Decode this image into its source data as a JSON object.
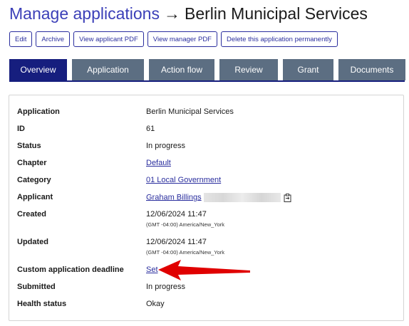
{
  "header": {
    "breadcrumb_link": "Manage applications",
    "arrow": "→",
    "application_name": "Berlin Municipal Services"
  },
  "actions": [
    {
      "label": "Edit"
    },
    {
      "label": "Archive"
    },
    {
      "label": "View applicant PDF"
    },
    {
      "label": "View manager PDF"
    },
    {
      "label": "Delete this application permanently"
    }
  ],
  "tabs": [
    {
      "label": "Overview",
      "active": true
    },
    {
      "label": "Application",
      "active": false
    },
    {
      "label": "Action flow",
      "active": false
    },
    {
      "label": "Review",
      "active": false
    },
    {
      "label": "Grant",
      "active": false
    },
    {
      "label": "Documents",
      "active": false
    }
  ],
  "details": {
    "application": {
      "label": "Application",
      "value": "Berlin Municipal Services"
    },
    "id": {
      "label": "ID",
      "value": "61"
    },
    "status": {
      "label": "Status",
      "value": "In progress"
    },
    "chapter": {
      "label": "Chapter",
      "value": "Default"
    },
    "category": {
      "label": "Category",
      "value": "01 Local Government"
    },
    "applicant": {
      "label": "Applicant",
      "value": "Graham Billings"
    },
    "created": {
      "label": "Created",
      "value": "12/06/2024 11:47",
      "tz": "(GMT -04:00) America/New_York"
    },
    "updated": {
      "label": "Updated",
      "value": "12/06/2024 11:47",
      "tz": "(GMT -04:00) America/New_York"
    },
    "deadline": {
      "label": "Custom application deadline",
      "value": "Set"
    },
    "submitted": {
      "label": "Submitted",
      "value": "In progress"
    },
    "health": {
      "label": "Health status",
      "value": "Okay"
    }
  },
  "icons": {
    "copy": "clipboard-icon",
    "annotation": "red-arrow-annotation"
  },
  "colors": {
    "link": "#3b3fb8",
    "tab_active": "#161e7e",
    "tab_inactive": "#5c6e82",
    "annotation": "#e00000"
  }
}
